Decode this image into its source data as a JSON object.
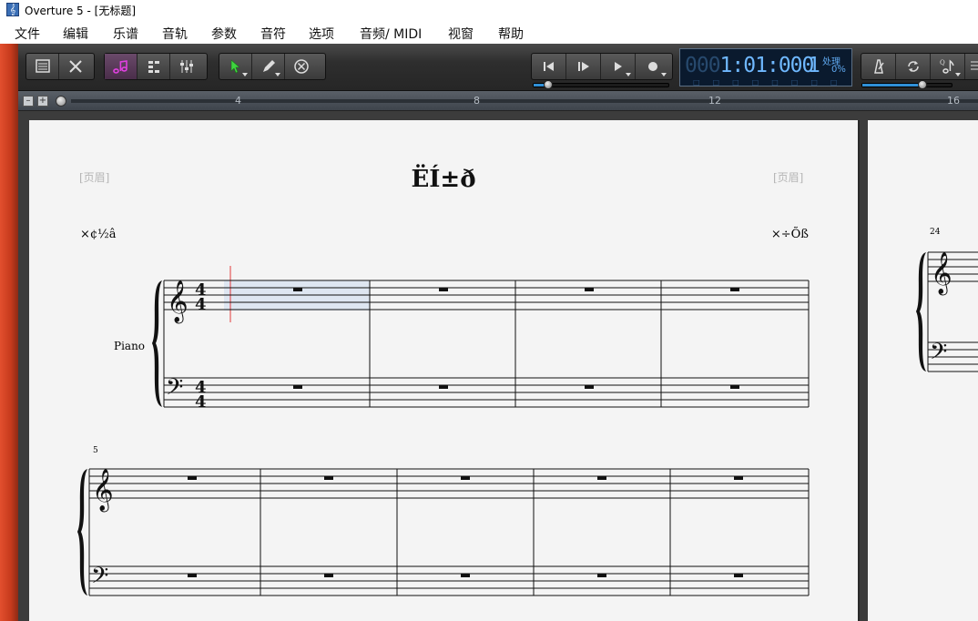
{
  "window": {
    "title": "Overture 5 - [无标题]",
    "app_icon_glyph": "𝄞"
  },
  "menu": {
    "items": [
      "文件",
      "编辑",
      "乐谱",
      "音轨",
      "参数",
      "音符",
      "选项",
      "音频/ MIDI",
      "视窗",
      "帮助"
    ]
  },
  "toolbar": {
    "left_tools": [
      "score-view-icon",
      "tools-icon"
    ],
    "view_tools": [
      "note-entry-icon",
      "piano-roll-icon",
      "mixer-icon"
    ],
    "edit_tools": [
      "select-arrow-icon",
      "pencil-icon",
      "eraser-icon"
    ],
    "transport": [
      "rewind-icon",
      "play-from-start-icon",
      "play-icon",
      "record-icon"
    ],
    "right_tools": [
      "metronome-icon",
      "loop-icon",
      "quantize-note-icon"
    ],
    "accent_color": "#e040e0",
    "arrow_color": "#3fd43f"
  },
  "position_display": {
    "dim_digits": "000",
    "bar": "1",
    "beat": "01",
    "tick": "000",
    "beat_unit": "1",
    "processing_label": "处理",
    "processing_value": "0%"
  },
  "ruler": {
    "marks": [
      "4",
      "8",
      "12",
      "16"
    ]
  },
  "score": {
    "header_left": "[页眉]",
    "header_right": "[页眉]",
    "title": "ËÍ±ð",
    "subtitle_left": "×¢½â",
    "subtitle_right": "×÷Õß",
    "instrument": "Piano",
    "time_signature_top": "4",
    "time_signature_bottom": "4",
    "system2_measure_number": "5",
    "page2_measure_number": "24"
  }
}
